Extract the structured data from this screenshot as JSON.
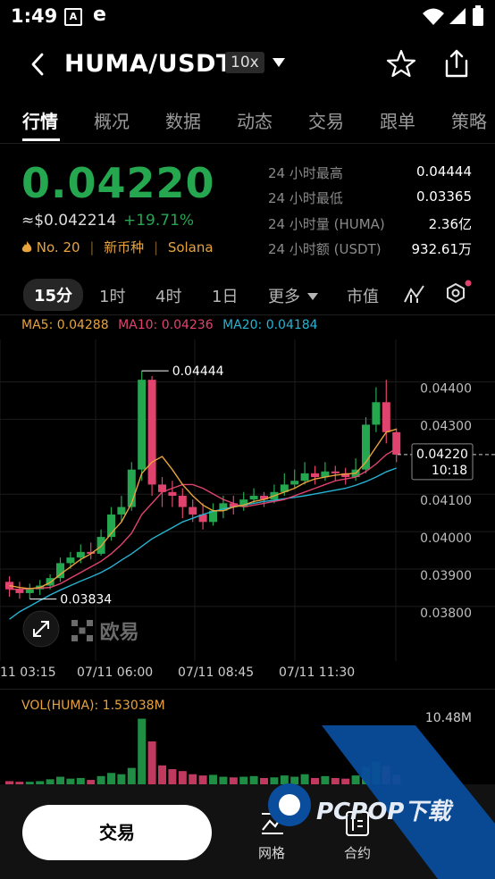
{
  "status_bar": {
    "time": "1:49",
    "icon_a": "A",
    "icon_e": "e"
  },
  "header": {
    "title": "HUMA/USDT",
    "leverage": "10x"
  },
  "tabs": [
    "行情",
    "概况",
    "数据",
    "动态",
    "交易",
    "跟单",
    "策略"
  ],
  "price": {
    "last": "0.04220",
    "usd": "≈$0.042214",
    "change": "+19.71%",
    "rank": "No. 20",
    "tag_new": "新币种",
    "chain": "Solana"
  },
  "stats": [
    {
      "label": "24 小时最高",
      "value": "0.04444"
    },
    {
      "label": "24 小时最低",
      "value": "0.03365"
    },
    {
      "label": "24 小时量 (HUMA)",
      "value": "2.36亿"
    },
    {
      "label": "24 小时额 (USDT)",
      "value": "932.61万"
    }
  ],
  "intervals": [
    "15分",
    "1时",
    "4时",
    "1日"
  ],
  "interval_more": "更多",
  "interval_market": "市值",
  "ma": {
    "ma5": "MA5: 0.04288",
    "ma10": "MA10: 0.04236",
    "ma20": "MA20: 0.04184"
  },
  "chart_marks": {
    "high_label": "0.04444",
    "low_label": "0.03834",
    "current_price": "0.04220",
    "countdown": "10:18"
  },
  "chart_data": {
    "type": "line",
    "x_tick_labels": [
      "11 03:15",
      "07/11 06:00",
      "07/11 08:45",
      "07/11 11:30"
    ],
    "y_tick_labels": [
      "0.04400",
      "0.04300",
      "0.04100",
      "0.04000",
      "0.03900",
      "0.03800"
    ],
    "ylim": [
      0.0374,
      0.0448
    ],
    "candles": [
      [
        0.0388,
        0.0386,
        0.03895,
        0.0384
      ],
      [
        0.0386,
        0.0385,
        0.0388,
        0.03835
      ],
      [
        0.0385,
        0.0386,
        0.03875,
        0.03834
      ],
      [
        0.0386,
        0.0387,
        0.03885,
        0.03845
      ],
      [
        0.0387,
        0.0389,
        0.039,
        0.0386
      ],
      [
        0.0389,
        0.0393,
        0.03945,
        0.0388
      ],
      [
        0.0393,
        0.03945,
        0.0396,
        0.03915
      ],
      [
        0.03945,
        0.0396,
        0.0398,
        0.0393
      ],
      [
        0.0396,
        0.03955,
        0.03985,
        0.0394
      ],
      [
        0.03955,
        0.04,
        0.0402,
        0.0395
      ],
      [
        0.04,
        0.0406,
        0.0408,
        0.0399
      ],
      [
        0.0406,
        0.0408,
        0.0411,
        0.0404
      ],
      [
        0.0408,
        0.0418,
        0.042,
        0.0407
      ],
      [
        0.0418,
        0.0442,
        0.04444,
        0.0415
      ],
      [
        0.0442,
        0.0414,
        0.0443,
        0.0411
      ],
      [
        0.0414,
        0.0412,
        0.0416,
        0.0408
      ],
      [
        0.0412,
        0.0411,
        0.0415,
        0.0408
      ],
      [
        0.0411,
        0.0408,
        0.0413,
        0.0405
      ],
      [
        0.0408,
        0.0406,
        0.041,
        0.0404
      ],
      [
        0.0406,
        0.0404,
        0.0409,
        0.0402
      ],
      [
        0.0404,
        0.0407,
        0.0409,
        0.0403
      ],
      [
        0.0407,
        0.0409,
        0.0411,
        0.0405
      ],
      [
        0.0409,
        0.0408,
        0.0411,
        0.0406
      ],
      [
        0.0408,
        0.041,
        0.0412,
        0.0407
      ],
      [
        0.041,
        0.0411,
        0.0413,
        0.0409
      ],
      [
        0.0411,
        0.041,
        0.0412,
        0.0408
      ],
      [
        0.041,
        0.0412,
        0.0414,
        0.0409
      ],
      [
        0.0412,
        0.0414,
        0.0417,
        0.0411
      ],
      [
        0.0414,
        0.0415,
        0.0418,
        0.0413
      ],
      [
        0.0415,
        0.0417,
        0.042,
        0.0414
      ],
      [
        0.0417,
        0.0416,
        0.0419,
        0.0414
      ],
      [
        0.0416,
        0.04175,
        0.042,
        0.0415
      ],
      [
        0.04175,
        0.0417,
        0.0419,
        0.0415
      ],
      [
        0.0417,
        0.0416,
        0.04185,
        0.0414
      ],
      [
        0.0416,
        0.0418,
        0.0421,
        0.0415
      ],
      [
        0.0418,
        0.043,
        0.0432,
        0.0417
      ],
      [
        0.043,
        0.0436,
        0.044,
        0.0428
      ],
      [
        0.0436,
        0.0428,
        0.0442,
        0.0425
      ],
      [
        0.0428,
        0.0422,
        0.0429,
        0.042
      ]
    ],
    "ma5": [
      0.0387,
      0.03865,
      0.03862,
      0.03865,
      0.03878,
      0.039,
      0.0392,
      0.0394,
      0.03955,
      0.03975,
      0.0401,
      0.0404,
      0.0409,
      0.0417,
      0.042,
      0.04215,
      0.0418,
      0.0414,
      0.0411,
      0.04085,
      0.0407,
      0.0407,
      0.0408,
      0.04085,
      0.04095,
      0.041,
      0.0411,
      0.0412,
      0.0413,
      0.04145,
      0.04155,
      0.0416,
      0.04165,
      0.04168,
      0.0417,
      0.042,
      0.0424,
      0.0428,
      0.04288
    ],
    "ma10": [
      0.0386,
      0.0386,
      0.03862,
      0.03863,
      0.03865,
      0.03875,
      0.0389,
      0.03905,
      0.0392,
      0.03935,
      0.03955,
      0.0398,
      0.0401,
      0.0406,
      0.0409,
      0.0412,
      0.0413,
      0.0414,
      0.0414,
      0.0413,
      0.04115,
      0.041,
      0.0409,
      0.0408,
      0.04085,
      0.0409,
      0.04095,
      0.041,
      0.0411,
      0.0412,
      0.0413,
      0.0414,
      0.0415,
      0.04155,
      0.0416,
      0.04175,
      0.04195,
      0.0422,
      0.04236
    ],
    "ma20": [
      0.0378,
      0.038,
      0.03815,
      0.0383,
      0.03845,
      0.03858,
      0.0387,
      0.03882,
      0.03893,
      0.03905,
      0.0392,
      0.03938,
      0.03955,
      0.03975,
      0.03995,
      0.0401,
      0.04025,
      0.0404,
      0.0405,
      0.0406,
      0.04068,
      0.04075,
      0.0408,
      0.04085,
      0.0409,
      0.04095,
      0.04098,
      0.04102,
      0.04106,
      0.0411,
      0.04115,
      0.0412,
      0.04125,
      0.0413,
      0.04138,
      0.04148,
      0.0416,
      0.04174,
      0.04184
    ],
    "volume": {
      "label": "VOL(HUMA): 1.53038M",
      "max_label": "10.48M",
      "values": [
        0.5,
        0.4,
        0.4,
        0.5,
        0.8,
        1.2,
        0.9,
        1.0,
        0.7,
        1.3,
        1.8,
        1.6,
        2.6,
        10.4,
        6.8,
        3.0,
        2.4,
        2.1,
        1.6,
        1.4,
        1.5,
        1.2,
        1.1,
        1.2,
        1.3,
        1.0,
        1.1,
        1.4,
        1.2,
        1.6,
        1.0,
        1.3,
        1.0,
        0.9,
        1.4,
        2.8,
        3.6,
        2.9,
        1.53
      ]
    }
  },
  "watermark": {
    "exchange": "欧易",
    "site": "PCPOP下载"
  },
  "bottom_bar": {
    "trade_label": "交易",
    "grid_label": "网格",
    "contract_label": "合约"
  },
  "colors": {
    "up": "#25a750",
    "down": "#e0446e",
    "ma5": "#e8a33c",
    "ma10": "#e0446e",
    "ma20": "#27b3d2",
    "watermark_blue": "#0a4d9c"
  }
}
